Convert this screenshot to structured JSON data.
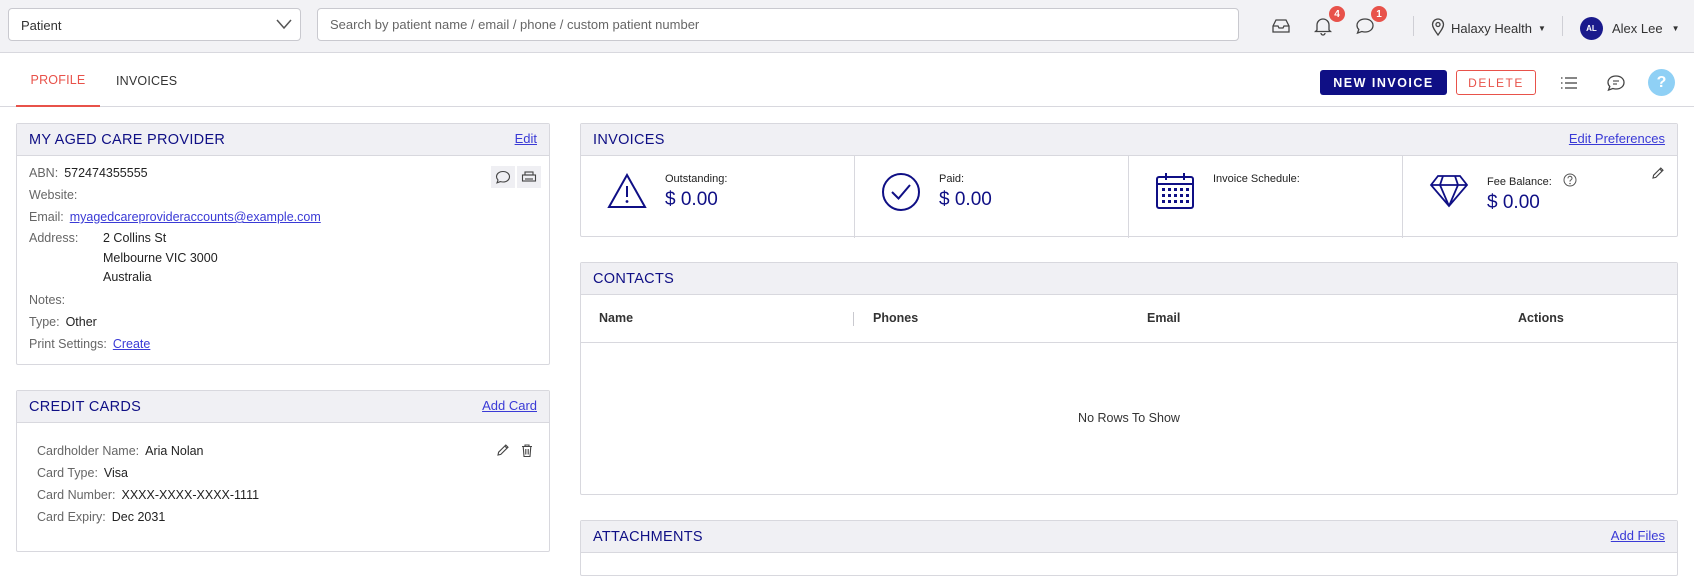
{
  "topbar": {
    "type_select_value": "Patient",
    "search_placeholder": "Search by patient name / email / phone / custom patient number",
    "notifications_count": "4",
    "messages_count": "1",
    "location_label": "Halaxy Health",
    "user_initials": "AL",
    "user_name": "Alex Lee"
  },
  "tabs": [
    {
      "label": "PROFILE",
      "active": true
    },
    {
      "label": "INVOICES",
      "active": false
    }
  ],
  "actions": {
    "new_invoice": "NEW INVOICE",
    "delete": "DELETE",
    "help": "?"
  },
  "provider": {
    "title": "MY AGED CARE PROVIDER",
    "edit_label": "Edit",
    "abn_label": "ABN:",
    "abn": "572474355555",
    "website_label": "Website:",
    "email_label": "Email:",
    "email": "myagedcareprovideraccounts@example.com",
    "address_label": "Address:",
    "address_lines": [
      "2 Collins St",
      "Melbourne VIC 3000",
      "Australia"
    ],
    "notes_label": "Notes:",
    "type_label": "Type:",
    "type": "Other",
    "print_label": "Print Settings:",
    "print_link": "Create"
  },
  "credit_cards": {
    "title": "CREDIT CARDS",
    "add_label": "Add Card",
    "holder_label": "Cardholder Name:",
    "holder": "Aria Nolan",
    "type_label": "Card Type:",
    "type": "Visa",
    "number_label": "Card Number:",
    "number": "XXXX-XXXX-XXXX-1111",
    "expiry_label": "Card Expiry:",
    "expiry": "Dec 2031"
  },
  "invoices": {
    "title": "INVOICES",
    "edit_prefs": "Edit Preferences",
    "outstanding_label": "Outstanding:",
    "outstanding": "$ 0.00",
    "paid_label": "Paid:",
    "paid": "$ 0.00",
    "schedule_label": "Invoice Schedule:",
    "fee_label": "Fee Balance:",
    "fee": "$ 0.00"
  },
  "contacts": {
    "title": "CONTACTS",
    "columns": [
      "Name",
      "Phones",
      "Email",
      "Actions"
    ],
    "empty": "No Rows To Show"
  },
  "attachments": {
    "title": "ATTACHMENTS",
    "add_label": "Add Files"
  },
  "colors": {
    "navy": "#0f0f85",
    "accent_red": "#e8524a",
    "link_blue": "#3a3ad6",
    "help_blue": "#8fd0f5"
  }
}
